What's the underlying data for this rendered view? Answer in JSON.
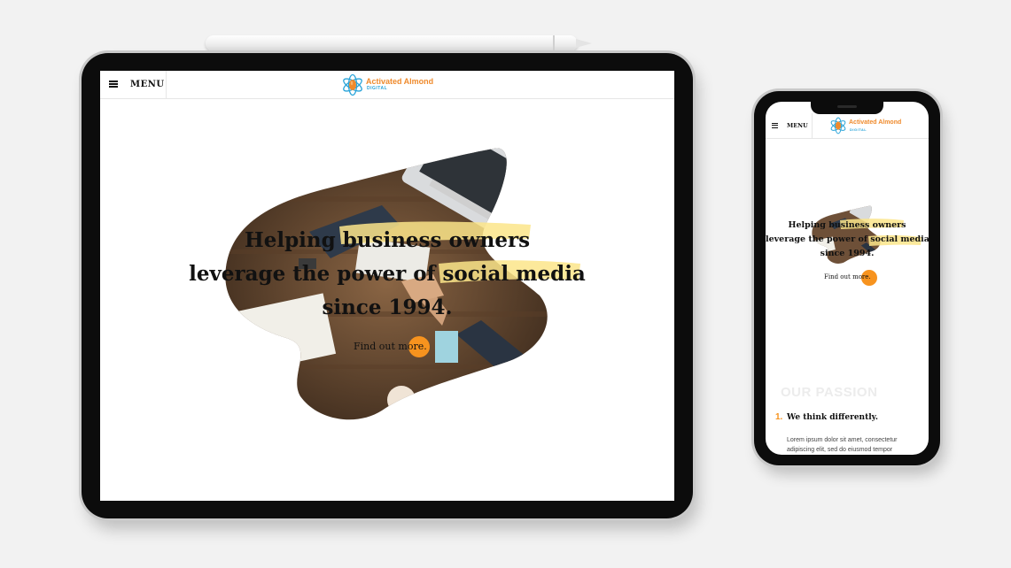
{
  "site": {
    "menu_label": "MENU",
    "logo_name": "Activated Almond",
    "logo_sub": "DIGITAL"
  },
  "hero": {
    "headline_line1": "Helping business owners",
    "headline_line2": "leverage the power of social media",
    "headline_line3": "since 1994.",
    "cta": "Find out more.",
    "accent_color": "#f7931e",
    "highlight_color": "#fbe58a"
  },
  "mobile": {
    "headline_line1": "Helping business owners",
    "headline_line2": "leverage the power of social media",
    "headline_line3": "since 1994.",
    "cta": "Find out more.",
    "section_title": "OUR PASSION",
    "item_number": "1.",
    "item_title": "We think differently.",
    "item_body": "Lorem ipsum dolor sit amet, consectetur adipiscing elit, sed do eiusmod tempor"
  }
}
